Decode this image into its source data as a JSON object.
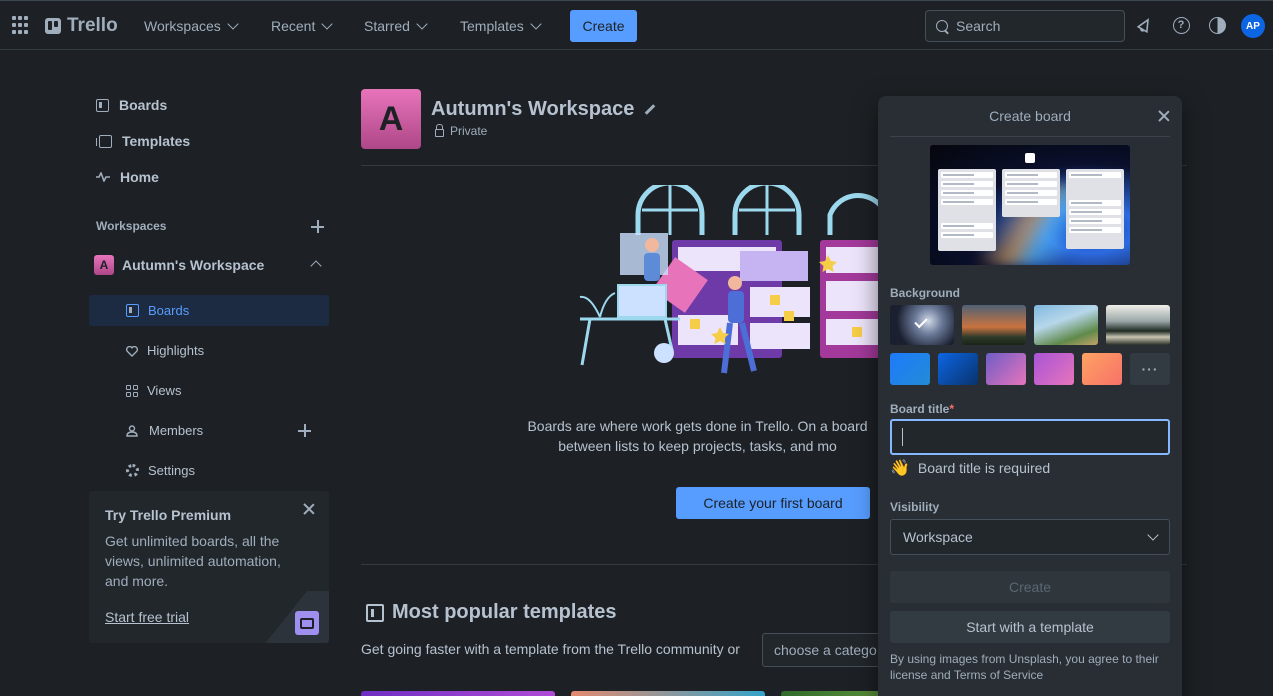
{
  "topbar": {
    "logo": "Trello",
    "nav": [
      "Workspaces",
      "Recent",
      "Starred",
      "Templates"
    ],
    "create_label": "Create",
    "search_placeholder": "Search",
    "avatar_initials": "AP"
  },
  "sidebar": {
    "top_items": [
      "Boards",
      "Templates",
      "Home"
    ],
    "workspaces_heading": "Workspaces",
    "workspace": {
      "initial": "A",
      "name": "Autumn's Workspace"
    },
    "sub_items": [
      "Boards",
      "Highlights",
      "Views",
      "Members",
      "Settings"
    ],
    "premium": {
      "title": "Try Trello Premium",
      "text": "Get unlimited boards, all the views, unlimited automation, and more.",
      "link": "Start free trial"
    }
  },
  "main": {
    "workspace_initial": "A",
    "workspace_name": "Autumn's Workspace",
    "visibility": "Private",
    "boards_text_line1": "Boards are where work gets done in Trello. On a board",
    "boards_text_line2": "between lists to keep projects, tasks, and mo",
    "first_board_button": "Create your first board",
    "templates_title": "Most popular templates",
    "templates_sub": "Get going faster with a template from the Trello community or",
    "category_placeholder": "choose a catego"
  },
  "create_board": {
    "title": "Create board",
    "background_label": "Background",
    "photo_backgrounds": [
      "abstract-glass",
      "mountain-sunset",
      "palm-tree",
      "lake-forest"
    ],
    "color_backgrounds": [
      "#1d7afc",
      "#0c66e4",
      "#6e5dc6",
      "#a854d7",
      "#fea362"
    ],
    "more_label": "···",
    "board_title_label": "Board title",
    "required_mark": "*",
    "board_title_value": "",
    "required_message": "Board title is required",
    "wave_emoji": "👋",
    "visibility_label": "Visibility",
    "visibility_value": "Workspace",
    "create_label": "Create",
    "template_label": "Start with a template",
    "unsplash_note": "By using images from Unsplash, you agree to their license and Terms of Service"
  },
  "colors": {
    "accent": "#579dff",
    "background": "#1d2125",
    "panel": "#282e33",
    "workspace_badge": "#e774bb"
  }
}
